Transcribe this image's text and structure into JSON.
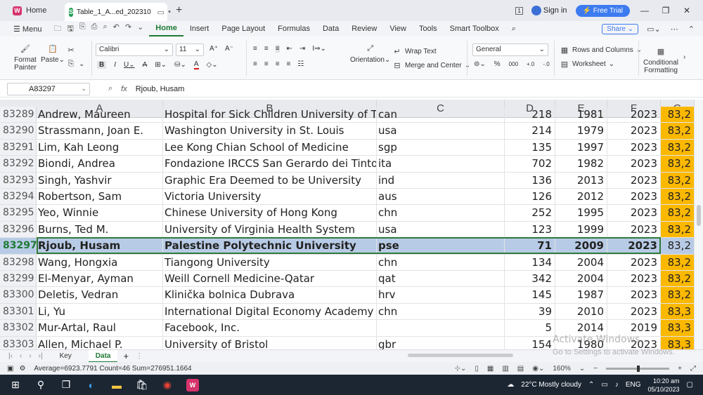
{
  "titlebar": {
    "home_tab": "Home",
    "file_tab": "Table_1_A...ed_202310",
    "sign_in": "Sign in",
    "free_trial": "Free Trial"
  },
  "menu": {
    "menu_label": "Menu",
    "tabs": [
      "Home",
      "Insert",
      "Page Layout",
      "Formulas",
      "Data",
      "Review",
      "View",
      "Tools",
      "Smart Toolbox"
    ],
    "active": "Home",
    "share": "Share"
  },
  "ribbon": {
    "format_painter": "Format Painter",
    "paste": "Paste",
    "font": "Calibri",
    "font_size": "11",
    "wrap_text": "Wrap Text",
    "merge_center": "Merge and Center",
    "orientation": "Orientation",
    "number_format": "General",
    "rows_columns": "Rows and Columns",
    "worksheet": "Worksheet",
    "conditional_formatting": "Conditional Formatting"
  },
  "formula_bar": {
    "name_box": "A83297",
    "fx": "fx",
    "value": "Rjoub, Husam"
  },
  "grid": {
    "columns": [
      "A",
      "B",
      "C",
      "D",
      "E",
      "F",
      "G"
    ],
    "rows": [
      {
        "n": "83289",
        "a": "Andrew, Maureen",
        "b": "Hospital for Sick Children University of Toronto",
        "c": "can",
        "d": "218",
        "e": "1981",
        "f": "2023",
        "g": "83,2"
      },
      {
        "n": "83290",
        "a": "Strassmann, Joan E.",
        "b": "Washington University in St. Louis",
        "c": "usa",
        "d": "214",
        "e": "1979",
        "f": "2023",
        "g": "83,2"
      },
      {
        "n": "83291",
        "a": "Lim, Kah Leong",
        "b": "Lee Kong Chian School of Medicine",
        "c": "sgp",
        "d": "135",
        "e": "1997",
        "f": "2023",
        "g": "83,2"
      },
      {
        "n": "83292",
        "a": "Biondi, Andrea",
        "b": "Fondazione IRCCS San Gerardo dei Tintori",
        "c": "ita",
        "d": "702",
        "e": "1982",
        "f": "2023",
        "g": "83,2"
      },
      {
        "n": "83293",
        "a": "Singh, Yashvir",
        "b": "Graphic Era Deemed to be University",
        "c": "ind",
        "d": "136",
        "e": "2013",
        "f": "2023",
        "g": "83,2"
      },
      {
        "n": "83294",
        "a": "Robertson, Sam",
        "b": "Victoria University",
        "c": "aus",
        "d": "126",
        "e": "2012",
        "f": "2023",
        "g": "83,2"
      },
      {
        "n": "83295",
        "a": "Yeo, Winnie",
        "b": "Chinese University of Hong Kong",
        "c": "chn",
        "d": "252",
        "e": "1995",
        "f": "2023",
        "g": "83,2"
      },
      {
        "n": "83296",
        "a": "Burns, Ted M.",
        "b": "University of Virginia Health System",
        "c": "usa",
        "d": "123",
        "e": "1999",
        "f": "2023",
        "g": "83,2"
      },
      {
        "n": "83297",
        "a": "Rjoub, Husam",
        "b": "Palestine Polytechnic University",
        "c": "pse",
        "d": "71",
        "e": "2009",
        "f": "2023",
        "g": "83,2",
        "selected": true
      },
      {
        "n": "83298",
        "a": "Wang, Hongxia",
        "b": "Tiangong University",
        "c": "chn",
        "d": "134",
        "e": "2004",
        "f": "2023",
        "g": "83,2"
      },
      {
        "n": "83299",
        "a": "El-Menyar, Ayman",
        "b": "Weill Cornell Medicine-Qatar",
        "c": "qat",
        "d": "342",
        "e": "2004",
        "f": "2023",
        "g": "83,2"
      },
      {
        "n": "83300",
        "a": "Deletis, Vedran",
        "b": "Klinička bolnica Dubrava",
        "c": "hrv",
        "d": "145",
        "e": "1987",
        "f": "2023",
        "g": "83,2"
      },
      {
        "n": "83301",
        "a": "Li, Yu",
        "b": "International Digital Economy Academy (IDEA)",
        "c": "chn",
        "d": "39",
        "e": "2010",
        "f": "2023",
        "g": "83,3"
      },
      {
        "n": "83302",
        "a": "Mur-Artal, Raul",
        "b": "Facebook, Inc.",
        "c": "",
        "d": "5",
        "e": "2014",
        "f": "2019",
        "g": "83,3"
      },
      {
        "n": "83303",
        "a": "Allen, Michael P.",
        "b": "University of Bristol",
        "c": "gbr",
        "d": "154",
        "e": "1980",
        "f": "2023",
        "g": "83,3"
      }
    ]
  },
  "sheets": {
    "tabs": [
      "Key",
      "Data"
    ],
    "active": "Data"
  },
  "watermark": {
    "line1": "Activate Windows",
    "line2": "Go to Settings to activate Windows."
  },
  "status": {
    "summary": "Average=6923.7791  Count=46  Sum=276951.1664",
    "zoom": "160%"
  },
  "taskbar": {
    "weather": "22°C  Mostly cloudy",
    "lang": "ENG",
    "time": "10:20 am",
    "date": "05/10/2023"
  }
}
